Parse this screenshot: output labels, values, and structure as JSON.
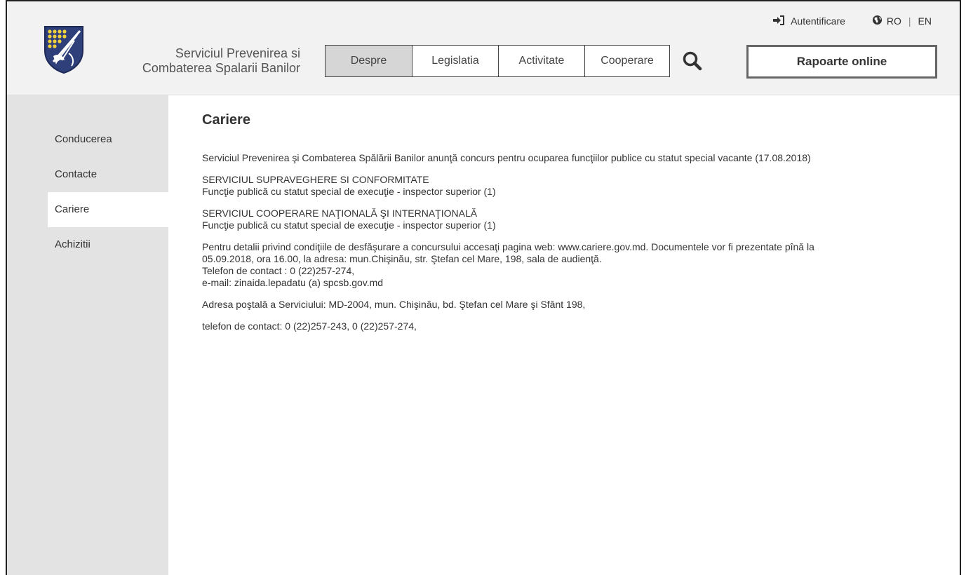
{
  "header": {
    "site_name_line1": "Serviciul Prevenirea si",
    "site_name_line2": "Combaterea Spalarii Banilor",
    "login_label": "Autentificare",
    "lang_ro": "RO",
    "lang_en": "EN",
    "lang_separator": "|",
    "reports_button": "Rapoarte online"
  },
  "nav": {
    "items": [
      {
        "label": "Despre"
      },
      {
        "label": "Legislatia"
      },
      {
        "label": "Activitate"
      },
      {
        "label": "Cooperare"
      }
    ]
  },
  "sidebar": {
    "items": [
      {
        "label": "Conducerea"
      },
      {
        "label": "Contacte"
      },
      {
        "label": "Cariere"
      },
      {
        "label": "Achizitii"
      }
    ]
  },
  "main": {
    "title": "Cariere",
    "paragraphs": [
      {
        "lines": [
          "Serviciul Prevenirea şi Combaterea Spălării Banilor anunţă concurs pentru ocuparea funcţiilor publice cu statut special  vacante (17.08.2018)"
        ]
      },
      {
        "lines": [
          "SERVICIUL SUPRAVEGHERE SI CONFORMITATE",
          "Funcţie publică cu statut special de execuţie -  inspector  superior (1)"
        ]
      },
      {
        "lines": [
          "SERVICIUL COOPERARE NAŢIONALĂ ŞI INTERNAŢIONALĂ",
          "Funcţie publică cu statut special de execuţie -  inspector  superior (1)"
        ]
      },
      {
        "lines": [
          "Pentru detalii privind condiţiile de desfăşurare a concursului accesaţi pagina web: www.cariere.gov.md. Documentele vor fi prezentate pînă la",
          "05.09.2018, ora 16.00, la adresa: mun.Chişinău, str. Ştefan cel Mare, 198, sala de audienţă.",
          "Telefon de contact : 0 (22)257-274,",
          "e-mail: zinaida.lepadatu (a) spcsb.gov.md"
        ]
      },
      {
        "lines": [
          "Adresa poştală a Serviciului: MD-2004, mun. Chişinău, bd. Ştefan cel Mare şi Sfânt 198,"
        ]
      },
      {
        "lines": [
          "telefon de contact: 0 (22)257-243, 0 (22)257-274,"
        ]
      }
    ]
  },
  "colors": {
    "header_bg": "#f2f2f2",
    "sidebar_bg": "#e3e3e3",
    "nav_active_bg": "#d6d6d6",
    "logo_blue": "#2f3f7a",
    "logo_yellow": "#f1d13a"
  },
  "icons": {
    "login": "sign-in-icon",
    "globe": "globe-icon",
    "search": "search-icon",
    "logo": "coat-of-arms-logo"
  }
}
